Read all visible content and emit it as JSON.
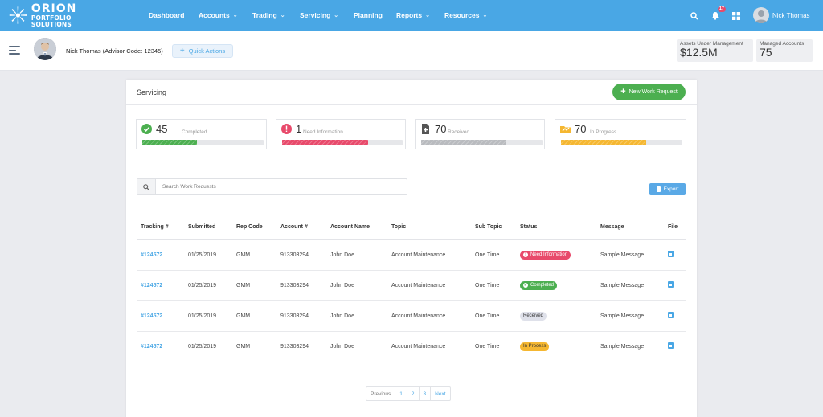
{
  "brand": {
    "line1": "ORION",
    "line2": "PORTFOLIO SOLUTIONS"
  },
  "nav": {
    "items": [
      {
        "label": "Dashboard",
        "dropdown": false
      },
      {
        "label": "Accounts",
        "dropdown": true
      },
      {
        "label": "Trading",
        "dropdown": true
      },
      {
        "label": "Servicing",
        "dropdown": true
      },
      {
        "label": "Planning",
        "dropdown": false
      },
      {
        "label": "Reports",
        "dropdown": true
      },
      {
        "label": "Resources",
        "dropdown": true
      }
    ],
    "notification_count": "17",
    "user_name": "Nick Thomas"
  },
  "subheader": {
    "advisor": "Nick Thomas (Advisor Code: 12345)",
    "quick_actions": "Quick Actions",
    "aum_label": "Assets Under Management",
    "aum_value": "$12.5M",
    "managed_label": "Managed Accounts",
    "managed_value": "75"
  },
  "panel": {
    "title": "Servicing",
    "new_request": "New Work Request",
    "cards": [
      {
        "count": "45",
        "caption": "Completed",
        "color": "#4caf50",
        "progress": 0.45
      },
      {
        "count": "1",
        "caption": "Need Information",
        "color": "#e84a6b",
        "progress": 0.71
      },
      {
        "count": "70",
        "caption": "Received",
        "color": "#b9bbbf",
        "progress": 0.7
      },
      {
        "count": "70",
        "caption": "In Progress",
        "color": "#f5b731",
        "progress": 0.7
      }
    ],
    "search_placeholder": "Search Work Requests",
    "export": "Export"
  },
  "table": {
    "headers": [
      "Tracking #",
      "Submitted",
      "Rep Code",
      "Account #",
      "Account Name",
      "Topic",
      "Sub Topic",
      "Status",
      "Message",
      "File"
    ],
    "rows": [
      {
        "tracking": "#124572",
        "submitted": "01/25/2019",
        "rep": "GMM",
        "account": "913303294",
        "name": "John Doe",
        "topic": "Account Maintenance",
        "subtopic": "One Time",
        "status": "Need Information",
        "status_kind": "need",
        "message": "Sample Message"
      },
      {
        "tracking": "#124572",
        "submitted": "01/25/2019",
        "rep": "GMM",
        "account": "913303294",
        "name": "John Doe",
        "topic": "Account Maintenance",
        "subtopic": "One Time",
        "status": "Completed",
        "status_kind": "done",
        "message": "Sample Message"
      },
      {
        "tracking": "#124572",
        "submitted": "01/25/2019",
        "rep": "GMM",
        "account": "913303294",
        "name": "John Doe",
        "topic": "Account Maintenance",
        "subtopic": "One Time",
        "status": "Received",
        "status_kind": "recv",
        "message": "Sample Message"
      },
      {
        "tracking": "#124572",
        "submitted": "01/25/2019",
        "rep": "GMM",
        "account": "913303294",
        "name": "John Doe",
        "topic": "Account Maintenance",
        "subtopic": "One Time",
        "status": "In Process",
        "status_kind": "proc",
        "message": "Sample Message"
      }
    ]
  },
  "pagination": {
    "prev": "Previous",
    "pages": [
      "1",
      "2",
      "3"
    ],
    "next": "Next"
  }
}
